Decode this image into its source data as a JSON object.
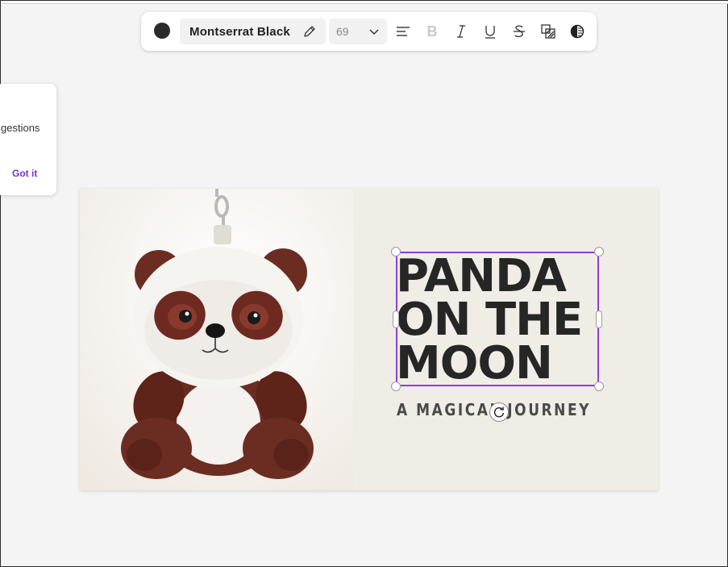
{
  "toolbar": {
    "text_color": "#2b2b2b",
    "font_name": "Montserrat Black",
    "font_size": "69",
    "icons": [
      "align-left-icon",
      "bold-icon",
      "italic-icon",
      "underline-icon",
      "strikethrough-icon",
      "effects-icon",
      "contrast-icon"
    ]
  },
  "tip": {
    "text": "gestions",
    "button": "Got it"
  },
  "canvas": {
    "title": "PANDA\nON THE\nMOON",
    "subtitle": "A MAGICAL JOURNEY",
    "accent": "#8b3fd9",
    "background": "#f0ede6"
  }
}
